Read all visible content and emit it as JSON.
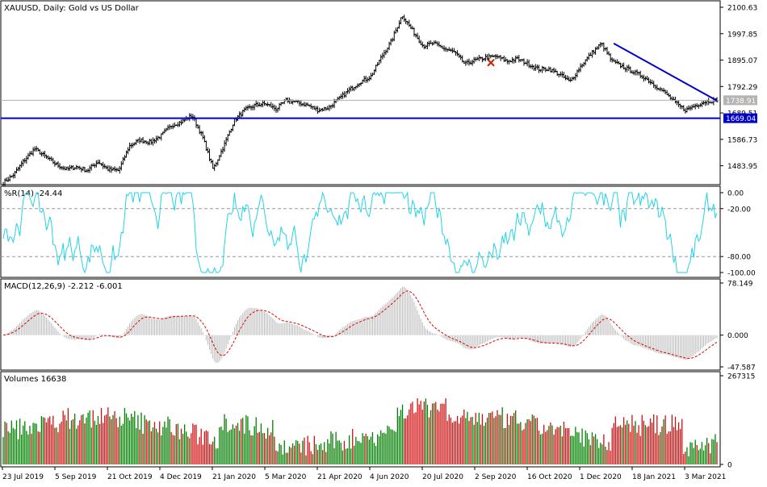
{
  "colors": {
    "price_bars": "#000000",
    "support_line": "#0000cc",
    "trend_line": "#0000cc",
    "current_price_line": "#b0b0b0",
    "wr_line": "#22d3e6",
    "macd_histogram": "#b8b8b8",
    "macd_signal": "#e00000",
    "volume_up": "#008000",
    "volume_down": "#d01010",
    "price_badge": "#0000cc",
    "price_label_grey": "#b4b4b4"
  },
  "x_axis": {
    "labels": [
      "23 Jul 2019",
      "5 Sep 2019",
      "21 Oct 2019",
      "4 Dec 2019",
      "21 Jan 2020",
      "5 Mar 2020",
      "21 Apr 2020",
      "4 Jun 2020",
      "20 Jul 2020",
      "2 Sep 2020",
      "16 Oct 2020",
      "1 Dec 2020",
      "18 Jan 2021",
      "3 Mar 2021"
    ]
  },
  "chart_data": [
    {
      "type": "candlestick",
      "title": "XAUUSD, Daily:  Gold vs US Dollar",
      "ylim": [
        1420,
        2110
      ],
      "y_ticks": [
        "2100.63",
        "1997.85",
        "1895.07",
        "1792.29",
        "1689.51",
        "1586.73",
        "1483.95"
      ],
      "current_price": 1738.91,
      "current_price_label": "1738.91",
      "support_level": 1669.04,
      "support_label": "1669.04",
      "trendline": {
        "from": {
          "date": "2020-12-31",
          "price": 1960
        },
        "to": {
          "date": "2021-03-31",
          "price": 1737
        }
      },
      "close_anchors": [
        1418,
        1450,
        1505,
        1550,
        1520,
        1490,
        1470,
        1480,
        1465,
        1500,
        1470,
        1465,
        1560,
        1585,
        1575,
        1600,
        1640,
        1655,
        1680,
        1595,
        1470,
        1560,
        1660,
        1700,
        1720,
        1725,
        1705,
        1740,
        1730,
        1720,
        1700,
        1710,
        1745,
        1780,
        1810,
        1830,
        1905,
        1970,
        2070,
        2010,
        1950,
        1960,
        1940,
        1925,
        1880,
        1895,
        1905,
        1910,
        1890,
        1900,
        1880,
        1860,
        1860,
        1840,
        1810,
        1870,
        1920,
        1960,
        1890,
        1870,
        1850,
        1830,
        1800,
        1770,
        1730,
        1700,
        1720,
        1735,
        1740
      ],
      "volume_label": "16638",
      "marker": {
        "label": "arrow-marker",
        "date": "2020-09-15",
        "price": 1885
      }
    },
    {
      "type": "line",
      "name_label": "%R(14) -24.44",
      "ylim": [
        -102,
        2
      ],
      "y_ticks": [
        "0.00",
        "-20.00",
        "-80.00",
        "-100.00"
      ],
      "levels": [
        -20,
        -80
      ]
    },
    {
      "type": "bar",
      "name_label": "MACD(12,26,9) -2.212 -6.001",
      "ylim": [
        -47.587,
        78.149
      ],
      "y_ticks": [
        "78.149",
        "0.000",
        "-47.587"
      ]
    },
    {
      "type": "bar",
      "name_label": "Volumes 16638",
      "ylim": [
        0,
        267315
      ],
      "y_ticks": [
        "267315",
        "0"
      ]
    }
  ]
}
